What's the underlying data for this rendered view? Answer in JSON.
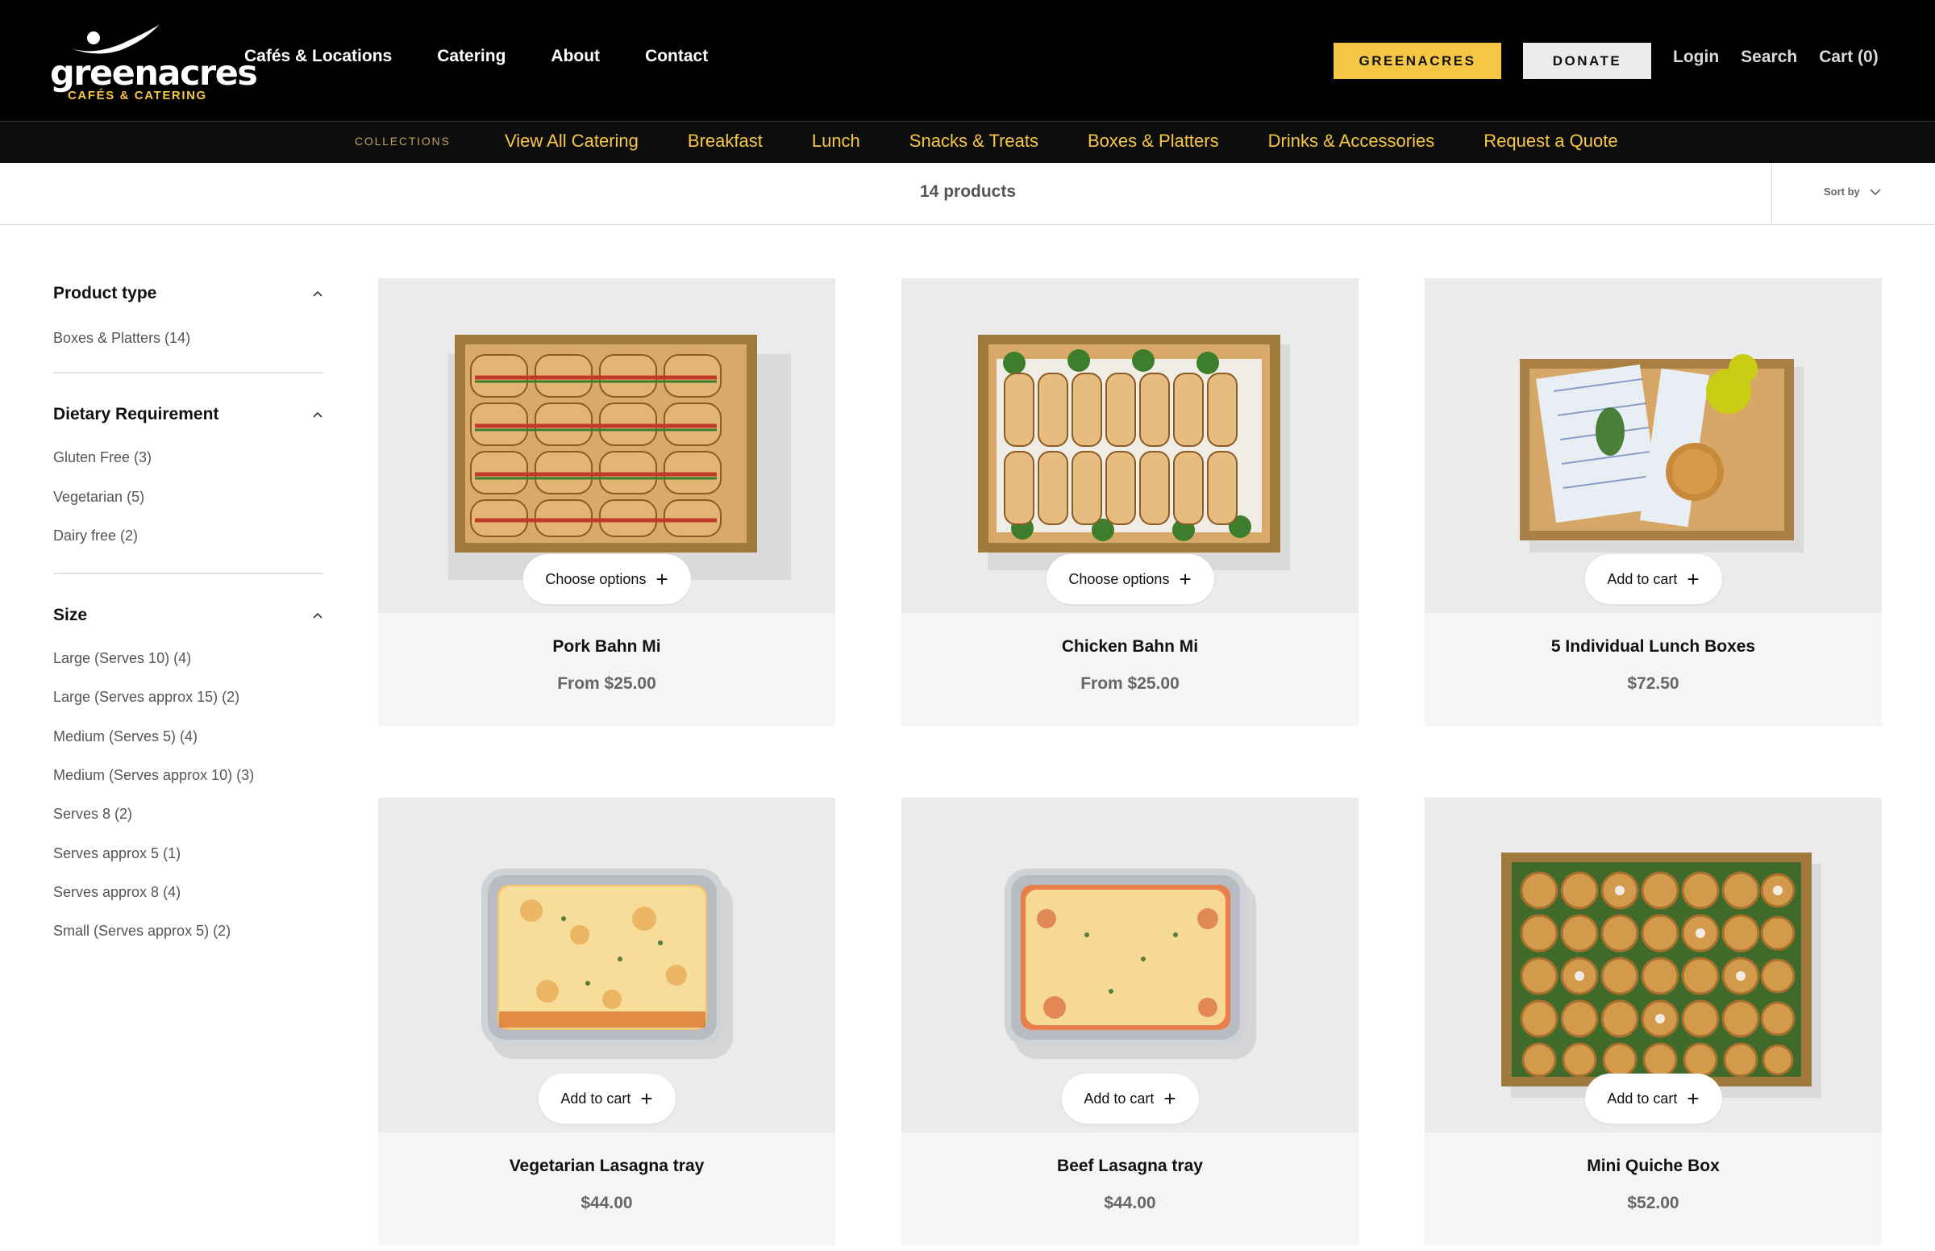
{
  "header": {
    "logo": {
      "word": "greenacres",
      "sub": "CAFÉS & CATERING"
    },
    "nav": [
      "Cafés & Locations",
      "Catering",
      "About",
      "Contact"
    ],
    "btn_greenacres": "GREENACRES",
    "btn_donate": "DONATE",
    "util": [
      "Login",
      "Search",
      "Cart (0)"
    ]
  },
  "collections": {
    "label": "COLLECTIONS",
    "items": [
      "View All Catering",
      "Breakfast",
      "Lunch",
      "Snacks & Treats",
      "Boxes & Platters",
      "Drinks & Accessories",
      "Request a Quote"
    ]
  },
  "toolbar": {
    "count": "14 products",
    "sort": "Sort by"
  },
  "filters": [
    {
      "title": "Product type",
      "items": [
        "Boxes & Platters (14)"
      ]
    },
    {
      "title": "Dietary Requirement",
      "items": [
        "Gluten Free (3)",
        "Vegetarian (5)",
        "Dairy free (2)"
      ]
    },
    {
      "title": "Size",
      "items": [
        "Large (Serves 10) (4)",
        "Large (Serves approx 15) (2)",
        "Medium (Serves 5) (4)",
        "Medium (Serves approx 10) (3)",
        "Serves 8 (2)",
        "Serves approx 5 (1)",
        "Serves approx 8 (4)",
        "Small (Serves approx 5) (2)"
      ]
    }
  ],
  "products": [
    {
      "name": "Pork Bahn Mi",
      "price": "From $25.00",
      "action": "Choose options",
      "image": "sandwich-box"
    },
    {
      "name": "Chicken Bahn Mi",
      "price": "From $25.00",
      "action": "Choose options",
      "image": "sandwich-box"
    },
    {
      "name": "5 Individual Lunch Boxes",
      "price": "$72.50",
      "action": "Add to cart",
      "image": "lunch-box"
    },
    {
      "name": "Vegetarian Lasagna tray",
      "price": "$44.00",
      "action": "Add to cart",
      "image": "lasagna-tray"
    },
    {
      "name": "Beef Lasagna tray",
      "price": "$44.00",
      "action": "Add to cart",
      "image": "lasagna-tray"
    },
    {
      "name": "Mini Quiche Box",
      "price": "$52.00",
      "action": "Add to cart",
      "image": "quiche-box"
    }
  ],
  "colors": {
    "accent": "#f6c744",
    "header_bg": "#000000",
    "card_bg": "#f5f5f5",
    "image_bg": "#ebebeb"
  }
}
